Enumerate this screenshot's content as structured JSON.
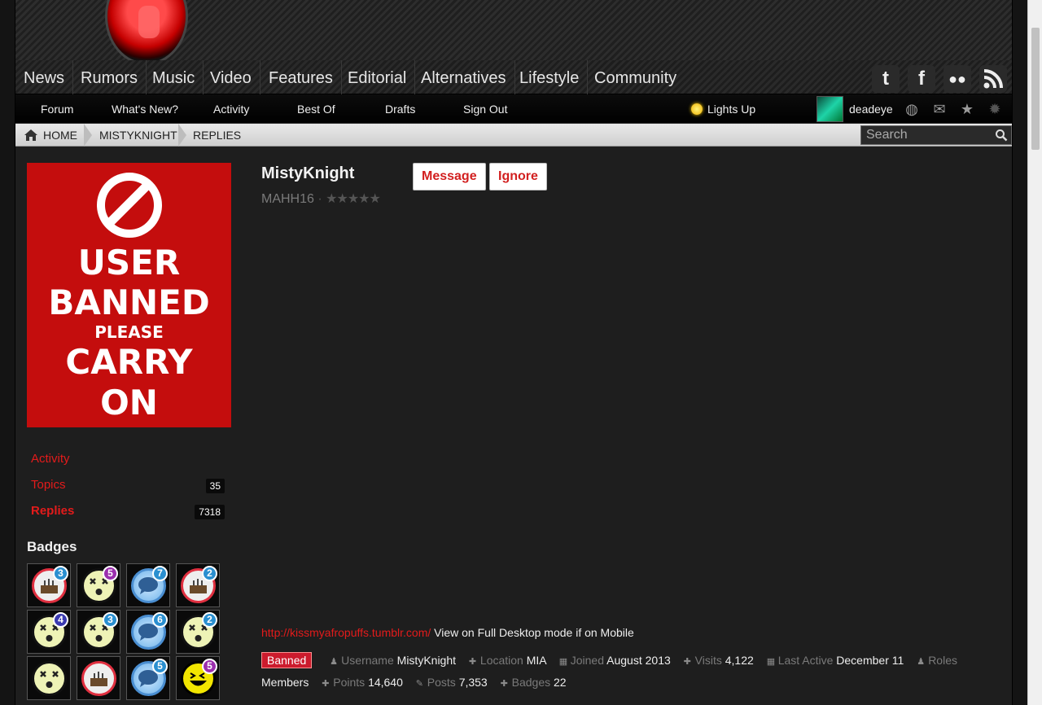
{
  "main_nav": [
    "News",
    "Rumors",
    "Music",
    "Video",
    "Features",
    "Editorial",
    "Alternatives",
    "Lifestyle",
    "Community"
  ],
  "social_icons": [
    "twitter-icon",
    "facebook-icon",
    "myspace-icon",
    "rss-icon"
  ],
  "sub_nav": [
    "Forum",
    "What's New?",
    "Activity",
    "Best Of",
    "Drafts",
    "Sign Out"
  ],
  "lights_up": "Lights Up",
  "current_user": "deadeye",
  "breadcrumb": [
    "HOME",
    "MISTYKNIGHT",
    "REPLIES"
  ],
  "search_placeholder": "Search",
  "banned_image": {
    "line1": "USER",
    "line2": "BANNED",
    "line3": "PLEASE",
    "line4": "CARRY",
    "line5": "ON"
  },
  "sidebar": {
    "activity": "Activity",
    "topics": {
      "label": "Topics",
      "count": "35"
    },
    "replies": {
      "label": "Replies",
      "count": "7318"
    },
    "badges_title": "Badges"
  },
  "badges": [
    {
      "icon": "cake-icon",
      "num": "3",
      "color": "#2a8fd0"
    },
    {
      "icon": "dead-face-icon",
      "num": "5",
      "color": "#9b2fae"
    },
    {
      "icon": "chat-bubble-icon",
      "num": "7",
      "color": "#2a8fd0"
    },
    {
      "icon": "cake-icon",
      "num": "2",
      "color": "#2a8fd0"
    },
    {
      "icon": "dead-face-icon",
      "num": "4",
      "color": "#3a3ab0"
    },
    {
      "icon": "dead-face-icon",
      "num": "3",
      "color": "#2a8fd0"
    },
    {
      "icon": "chat-bubble-icon",
      "num": "6",
      "color": "#2a8fd0"
    },
    {
      "icon": "dead-face-icon",
      "num": "2",
      "color": "#2a8fd0"
    },
    {
      "icon": "dead-face-icon",
      "num": "",
      "color": ""
    },
    {
      "icon": "cake-icon",
      "num": "",
      "color": ""
    },
    {
      "icon": "chat-bubble-icon",
      "num": "5",
      "color": "#2a8fd0"
    },
    {
      "icon": "laughing-face-icon",
      "num": "5",
      "color": "#9b2fae"
    }
  ],
  "profile": {
    "name": "MistyKnight",
    "title": "MAHH16",
    "rating_stars": "★★★★★",
    "message_btn": "Message",
    "ignore_btn": "Ignore",
    "bio_link": "http://kissmyafropuffs.tumblr.com/",
    "bio_text": "View on Full Desktop mode if on Mobile",
    "status": "Banned",
    "username_label": "Username",
    "username": "MistyKnight",
    "location_label": "Location",
    "location": "MIA",
    "joined_label": "Joined",
    "joined": "August 2013",
    "visits_label": "Visits",
    "visits": "4,122",
    "last_active_label": "Last Active",
    "last_active": "December 11",
    "roles_label": "Roles",
    "roles": "Members",
    "points_label": "Points",
    "points": "14,640",
    "posts_label": "Posts",
    "posts": "7,353",
    "badges_label": "Badges",
    "badges_count": "22"
  },
  "colors": {
    "accent": "#e31b1b",
    "banned": "#c40d0d"
  }
}
